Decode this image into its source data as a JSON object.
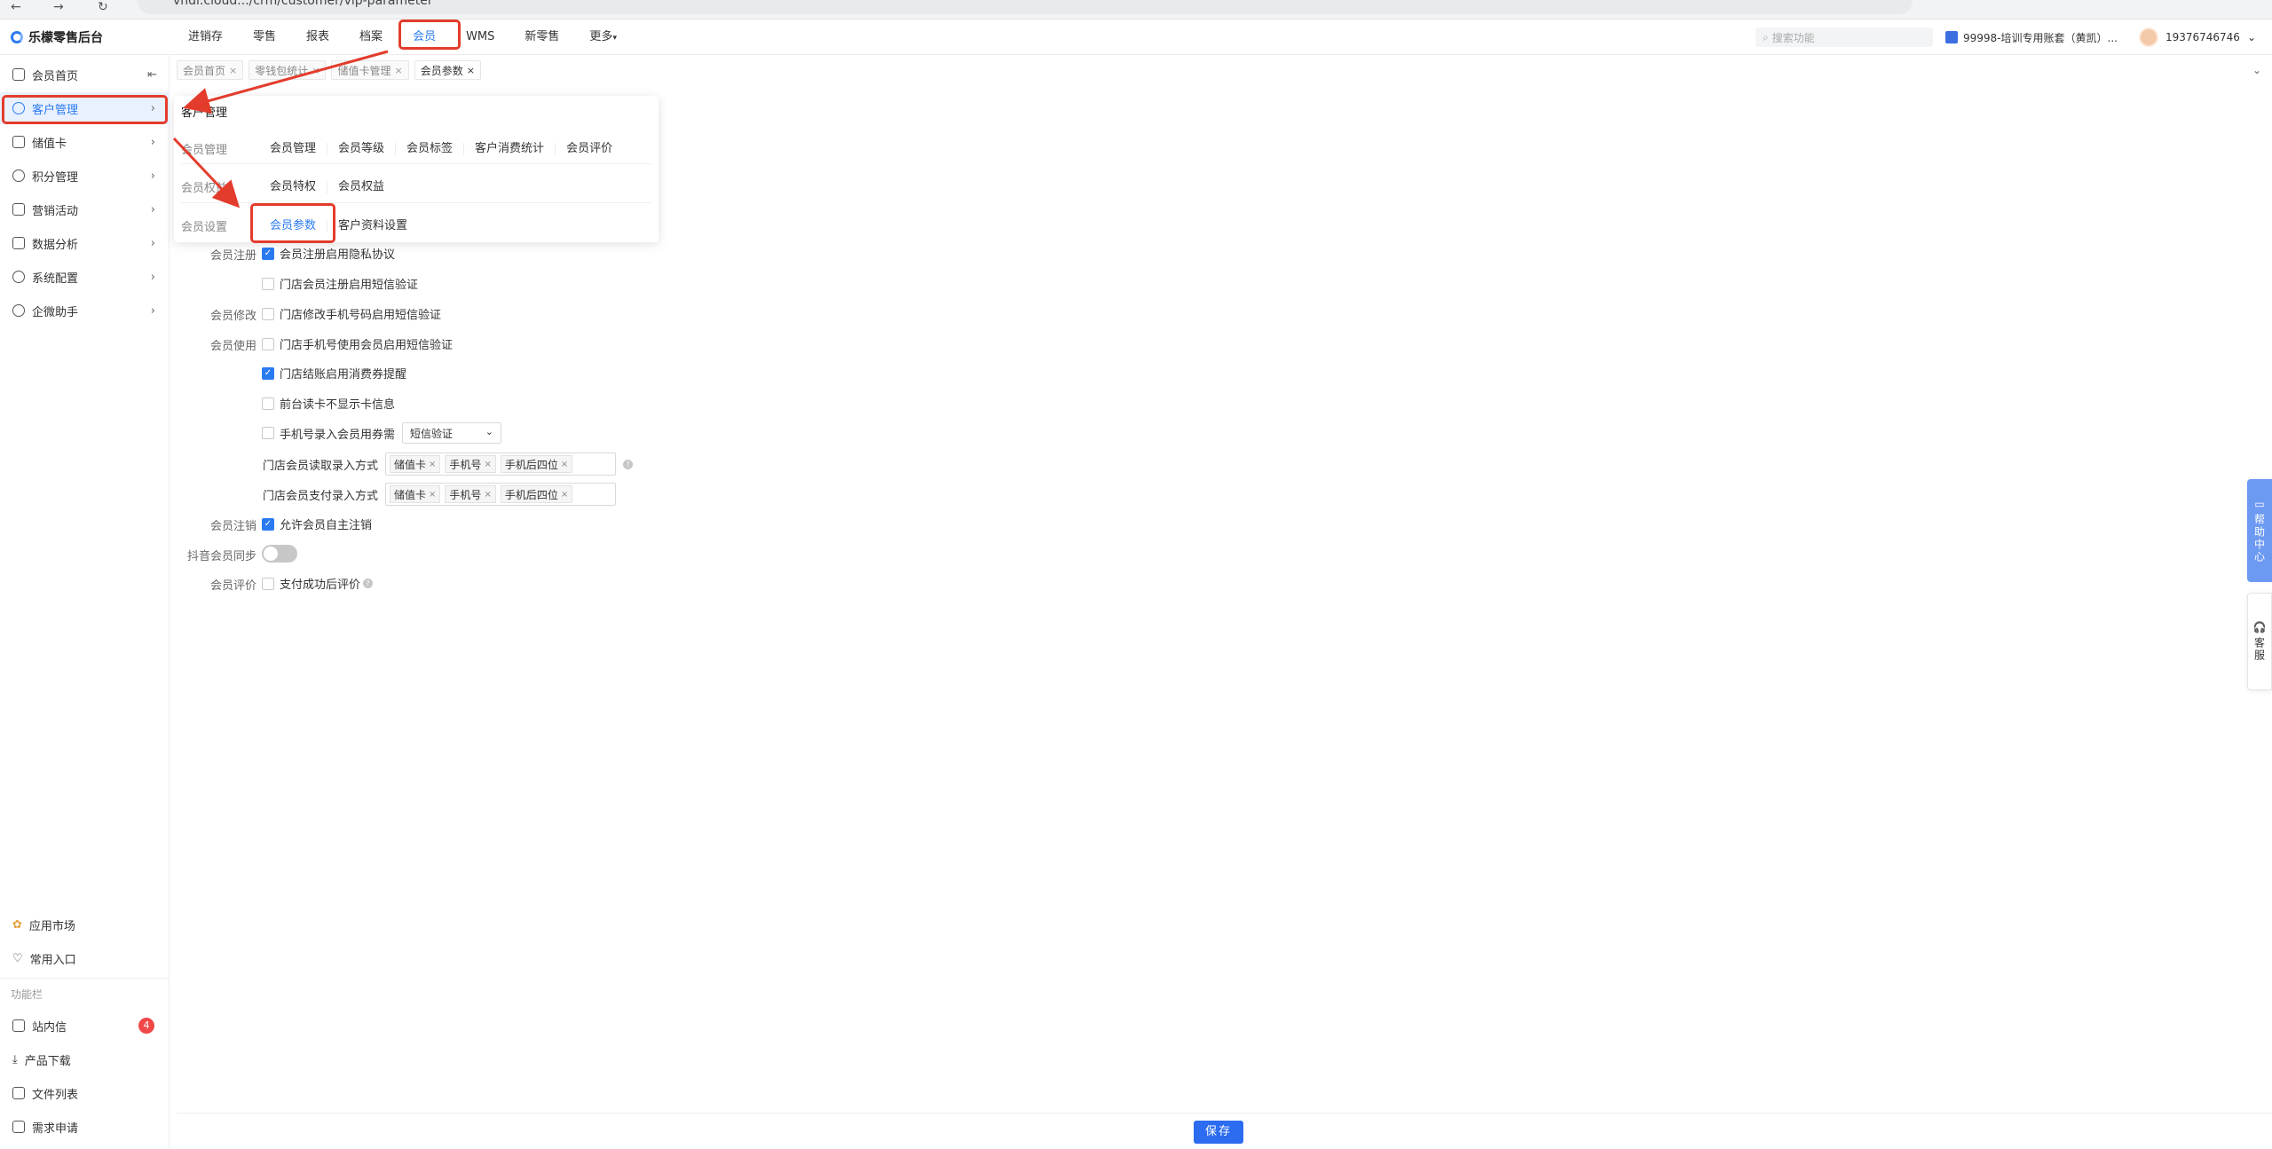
{
  "browser": {
    "url": "vhdi.cloud.../crm/customer/vip-parameter"
  },
  "app": {
    "brand": "乐檬零售后台"
  },
  "top_nav": [
    "进销存",
    "零售",
    "报表",
    "档案",
    "会员",
    "WMS",
    "新零售",
    "更多"
  ],
  "top_nav_active": "会员",
  "search": {
    "placeholder": "搜索功能"
  },
  "account": {
    "label": "99998-培训专用账套（黄凯）..."
  },
  "user": {
    "phone": "19376746746"
  },
  "sidebar": {
    "items": [
      {
        "label": "会员首页",
        "icon": "home-icon"
      },
      {
        "label": "客户管理",
        "icon": "user-icon"
      },
      {
        "label": "储值卡",
        "icon": "card-icon"
      },
      {
        "label": "积分管理",
        "icon": "coins-icon"
      },
      {
        "label": "营销活动",
        "icon": "monitor-icon"
      },
      {
        "label": "数据分析",
        "icon": "chart-icon"
      },
      {
        "label": "系统配置",
        "icon": "settings-icon"
      },
      {
        "label": "企微助手",
        "icon": "chat-icon"
      }
    ],
    "bottom": [
      {
        "label": "应用市场",
        "icon": "app-market-icon"
      },
      {
        "label": "常用入口",
        "icon": "heart-icon"
      }
    ],
    "section_title": "功能栏",
    "tools": [
      {
        "label": "站内信",
        "icon": "mail-icon",
        "badge": "4"
      },
      {
        "label": "产品下载",
        "icon": "download-icon"
      },
      {
        "label": "文件列表",
        "icon": "file-icon"
      },
      {
        "label": "需求申请",
        "icon": "request-icon"
      }
    ]
  },
  "tabs": [
    "会员首页",
    "零钱包统计",
    "储值卡管理",
    "会员参数"
  ],
  "dropdown": {
    "title": "客户管理",
    "rows": [
      {
        "category": "会员管理",
        "links": [
          "会员管理",
          "会员等级",
          "会员标签",
          "客户消费统计",
          "会员评价"
        ]
      },
      {
        "category": "会员权益",
        "links": [
          "会员特权",
          "会员权益"
        ]
      },
      {
        "category": "会员设置",
        "links": [
          "会员参数",
          "客户资料设置"
        ]
      }
    ]
  },
  "form": {
    "register_label": "会员注册",
    "register_opt1": "会员注册启用隐私协议",
    "register_opt2": "门店会员注册启用短信验证",
    "modify_label": "会员修改",
    "modify_opt1": "门店修改手机号码启用短信验证",
    "use_label": "会员使用",
    "use_opt1": "门店手机号使用会员启用短信验证",
    "use_opt2": "门店结账启用消费券提醒",
    "use_opt3": "前台读卡不显示卡信息",
    "use_opt4": "手机号录入会员用券需",
    "use_opt4_select": "短信验证",
    "read_method_label": "门店会员读取录入方式",
    "pay_method_label": "门店会员支付录入方式",
    "method_tags": [
      "储值卡",
      "手机号",
      "手机后四位"
    ],
    "cancel_label": "会员注销",
    "cancel_opt1": "允许会员自主注销",
    "douyin_label": "抖音会员同步",
    "review_label": "会员评价",
    "review_opt1": "支付成功后评价"
  },
  "float": {
    "help": "帮助中心",
    "service": "客服"
  },
  "footer": {
    "save": "保存"
  },
  "colors": {
    "accent": "#2b7bf0",
    "highlight": "#e33c2c"
  }
}
